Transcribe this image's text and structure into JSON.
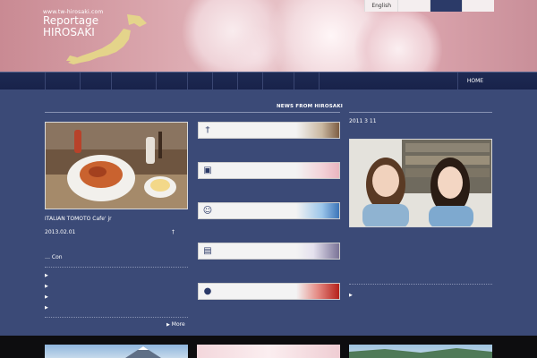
{
  "header": {
    "site_url": "www.tw-hirosaki.com",
    "site_name_line1": "Reportage",
    "site_name_line2": "HIROSAKI",
    "site_subtitle": "",
    "languages": [
      {
        "label": "English",
        "active": false
      },
      {
        "label": "",
        "active": false
      },
      {
        "label": "",
        "active": true
      },
      {
        "label": "",
        "active": false
      }
    ]
  },
  "nav": {
    "items": [
      {
        "label": "",
        "width": 40
      },
      {
        "label": "",
        "width": 35
      },
      {
        "label": "",
        "width": 50
      },
      {
        "label": "",
        "width": 35
      },
      {
        "label": "",
        "width": 28
      },
      {
        "label": "",
        "width": 28
      },
      {
        "label": "",
        "width": 28
      },
      {
        "label": "",
        "width": 35
      },
      {
        "label": "",
        "width": 28
      }
    ],
    "home": "HOME"
  },
  "left": {
    "title": "",
    "news_from": "NEWS FROM HIROSAKI",
    "article_title": "ITALIAN TOMOTO Cafe' jr",
    "date": "2013.02.01",
    "tag": "",
    "excerpt_line1": "",
    "excerpt_line2": "… Con",
    "bullets": [
      "",
      "",
      "",
      ""
    ],
    "more": "More"
  },
  "middle": {
    "categories": [
      {
        "icon": "fork-knife-icon",
        "glyph": "†",
        "label": "",
        "caption": ""
      },
      {
        "icon": "camera-icon",
        "glyph": "▣",
        "label": "",
        "caption": ""
      },
      {
        "icon": "smiley-icon",
        "glyph": "☺",
        "label": "",
        "caption": ""
      },
      {
        "icon": "bag-icon",
        "glyph": "▤",
        "label": "",
        "caption": ""
      },
      {
        "icon": "apple-icon",
        "glyph": "●",
        "label": "",
        "caption": ""
      }
    ]
  },
  "right": {
    "title": "",
    "intro_line1": "2011 3 11",
    "intro_line2": "",
    "caption": "",
    "para_lines": [
      "",
      "",
      "",
      ""
    ],
    "link": ""
  },
  "colors": {
    "nav_bg": "#1e2a53",
    "body_bg": "#3b4a77",
    "lang_active": "#2b3a68"
  }
}
